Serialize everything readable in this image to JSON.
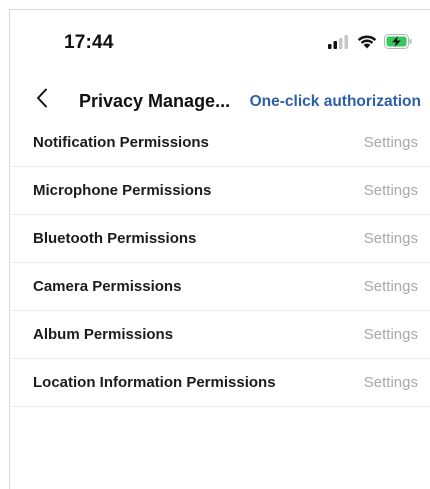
{
  "status_bar": {
    "time": "17:44",
    "icons": [
      "signal-icon",
      "wifi-icon",
      "battery-charging-icon"
    ],
    "battery_color": "#34c759"
  },
  "nav": {
    "back_icon": "chevron-left-icon",
    "title": "Privacy Manage...",
    "action_label": "One-click authorization",
    "action_color": "#2f5fa6"
  },
  "permissions": [
    {
      "label": "Notification Permissions",
      "action": "Settings"
    },
    {
      "label": "Microphone Permissions",
      "action": "Settings"
    },
    {
      "label": "Bluetooth Permissions",
      "action": "Settings"
    },
    {
      "label": "Camera Permissions",
      "action": "Settings"
    },
    {
      "label": "Album Permissions",
      "action": "Settings"
    },
    {
      "label": "Location Information Permissions",
      "action": "Settings"
    }
  ]
}
